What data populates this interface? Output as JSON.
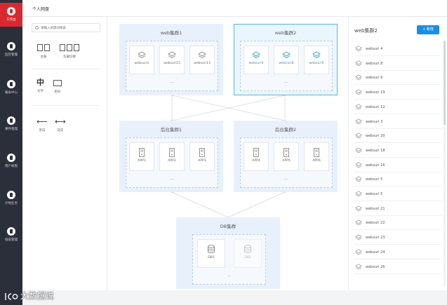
{
  "topbar": {
    "title": "个人网盘"
  },
  "nav": [
    {
      "label": "工作台",
      "icon": "dashboard-icon",
      "active": true
    },
    {
      "label": "监控管理",
      "icon": "monitor-icon"
    },
    {
      "label": "报表中心",
      "icon": "report-icon"
    },
    {
      "label": "事件管理",
      "icon": "event-icon"
    },
    {
      "label": "用户权限",
      "icon": "user-icon"
    },
    {
      "label": "计划任务",
      "icon": "task-icon"
    },
    {
      "label": "值班管理",
      "icon": "duty-icon"
    }
  ],
  "palette": {
    "search_placeholder": "请输入关键词搜索",
    "items": [
      {
        "label": "主备",
        "icon": "master-slave-icon"
      },
      {
        "label": "负载均衡",
        "icon": "load-balance-icon"
      },
      {
        "label": "文字",
        "icon": "text-icon",
        "glyph": "中"
      },
      {
        "label": "矩形",
        "icon": "rectangle-icon"
      },
      {
        "label": "单向",
        "icon": "one-way-arrow-icon",
        "glyph": "⟵"
      },
      {
        "label": "双向",
        "icon": "two-way-arrow-icon",
        "glyph": "⟷"
      }
    ]
  },
  "clusters": {
    "web1": {
      "title": "web集群1",
      "nodes": [
        "websuri1",
        "websuri15",
        "websuri13"
      ],
      "more": "..."
    },
    "web2": {
      "title": "web集群2",
      "nodes": [
        "websuri4",
        "websuri8",
        "websuri9"
      ],
      "more": "..."
    },
    "app1": {
      "title": "后台集群1",
      "nodes": [
        "APP1",
        "APP2",
        "APP3"
      ],
      "more": "..."
    },
    "app2": {
      "title": "后台集群2",
      "nodes": [
        "APP4",
        "APP5",
        "APP6"
      ],
      "more": "..."
    },
    "db": {
      "title": "DB集群",
      "nodes": [
        "DB1",
        "DB2"
      ],
      "more": "..."
    }
  },
  "panel": {
    "title": "web集群2",
    "add_label": "+ 新增",
    "items": [
      "websuri 4",
      "websuri 8",
      "websuri 9",
      "websuri 19",
      "websuri 12",
      "websuri 3",
      "websuri 20",
      "websuri 18",
      "websuri 16",
      "websuri 5",
      "websuri 5",
      "websuri 21",
      "websuri 22",
      "websuri 23",
      "websuri 24",
      "websuri 26"
    ]
  },
  "watermark": {
    "text": "大数据说"
  },
  "colors": {
    "accent": "#1a8ee6",
    "nav_bg": "#2b2f3a",
    "active": "#d9292f",
    "selected_border": "#5bb4e5",
    "cluster_bg": "#e8f1fb"
  }
}
